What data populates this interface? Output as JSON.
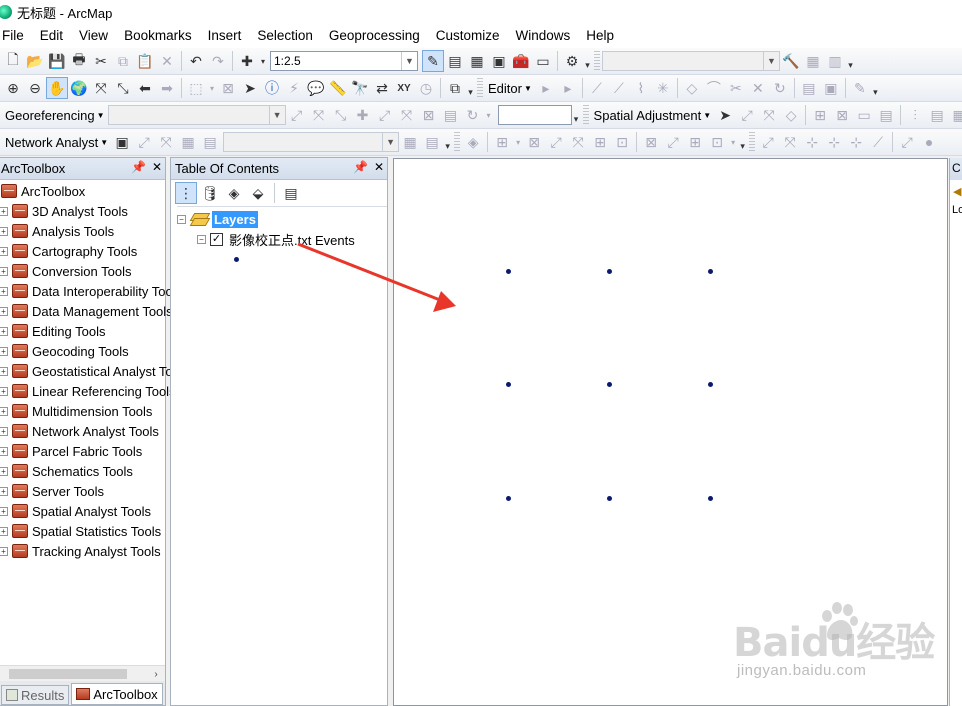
{
  "window": {
    "title": "无标题 - ArcMap"
  },
  "menu": [
    "File",
    "Edit",
    "View",
    "Bookmarks",
    "Insert",
    "Selection",
    "Geoprocessing",
    "Customize",
    "Windows",
    "Help"
  ],
  "standard_toolbar": {
    "scale_value": "1:2.5"
  },
  "editor_toolbar": {
    "label": "Editor"
  },
  "georef_toolbar": {
    "label": "Georeferencing"
  },
  "spatial_adjustment_toolbar": {
    "label": "Spatial Adjustment"
  },
  "network_toolbar": {
    "label": "Network Analyst"
  },
  "arctoolbox": {
    "header": "ArcToolbox",
    "root": "ArcToolbox",
    "items": [
      "3D Analyst Tools",
      "Analysis Tools",
      "Cartography Tools",
      "Conversion Tools",
      "Data Interoperability Tools",
      "Data Management Tools",
      "Editing Tools",
      "Geocoding Tools",
      "Geostatistical Analyst Tools",
      "Linear Referencing Tools",
      "Multidimension Tools",
      "Network Analyst Tools",
      "Parcel Fabric Tools",
      "Schematics Tools",
      "Server Tools",
      "Spatial Analyst Tools",
      "Spatial Statistics Tools",
      "Tracking Analyst Tools"
    ],
    "tabs": [
      "Results",
      "ArcToolbox"
    ]
  },
  "toc": {
    "header": "Table Of Contents",
    "root_label": "Layers",
    "layer_label": "影像校正点.txt Events",
    "layer_checked": "✓"
  },
  "map": {
    "point_color": "#0a1a6e",
    "annotation_arrow_color": "#e8362a"
  },
  "right_panel": {
    "header_stub": "C",
    "row_stub": "Lo"
  },
  "watermark": {
    "brand": "Baidu经验",
    "url": "jingyan.baidu.com"
  }
}
